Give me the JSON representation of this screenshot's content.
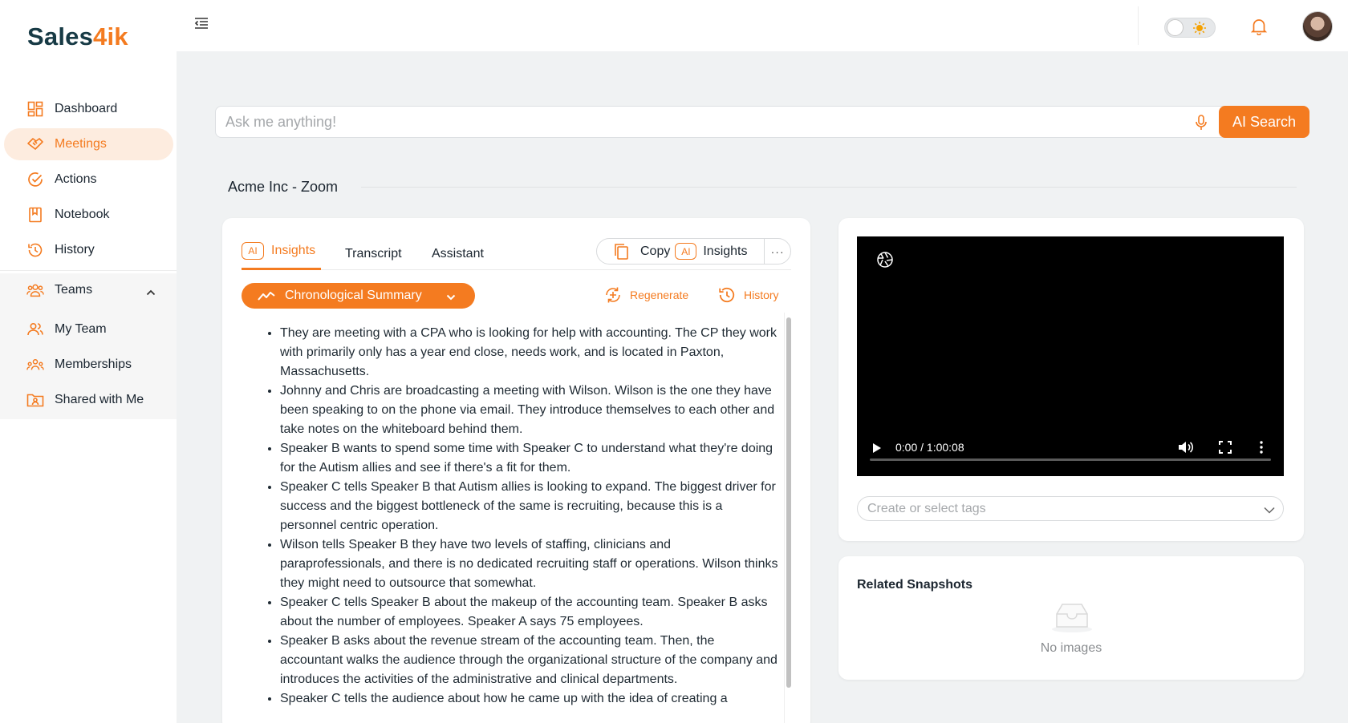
{
  "brand": {
    "logo_part1": "Sales",
    "logo_part2": "4ik"
  },
  "sidebar": {
    "items": [
      {
        "label": "Dashboard",
        "icon": "dashboard-icon"
      },
      {
        "label": "Meetings",
        "icon": "handshake-icon",
        "active": true
      },
      {
        "label": "Actions",
        "icon": "check-circle-icon"
      },
      {
        "label": "Notebook",
        "icon": "notebook-icon"
      },
      {
        "label": "History",
        "icon": "history-icon"
      }
    ],
    "teams": {
      "label": "Teams",
      "expanded": true,
      "children": [
        {
          "label": "My Team",
          "icon": "users-icon"
        },
        {
          "label": "Memberships",
          "icon": "group-icon"
        },
        {
          "label": "Shared with Me",
          "icon": "shared-folder-icon"
        }
      ]
    }
  },
  "topbar": {
    "theme": "light"
  },
  "search": {
    "placeholder": "Ask me anything!",
    "button_label": "AI Search"
  },
  "page": {
    "title": "Acme Inc - Zoom"
  },
  "insights_panel": {
    "tabs": [
      {
        "label": "Insights",
        "badge": "AI",
        "active": true
      },
      {
        "label": "Transcript"
      },
      {
        "label": "Assistant"
      }
    ],
    "copy_label": "Copy",
    "copy_badge": "AI",
    "copy_target": "Insights",
    "more_label": "···",
    "summary_type": "Chronological Summary",
    "regenerate_label": "Regenerate",
    "history_label": "History",
    "summary": [
      "They are meeting with a CPA who is looking for help with accounting. The CP they work with primarily only has a year end close, needs work, and is located in Paxton, Massachusetts.",
      "Johnny and Chris are broadcasting a meeting with Wilson. Wilson is the one they have been speaking to on the phone via email. They introduce themselves to each other and take notes on the whiteboard behind them.",
      "Speaker B wants to spend some time with Speaker C to understand what they're doing for the Autism allies and see if there's a fit for them.",
      "Speaker C tells Speaker B that Autism allies is looking to expand. The biggest driver for success and the biggest bottleneck of the same is recruiting, because this is a personnel centric operation.",
      "Wilson tells Speaker B they have two levels of staffing, clinicians and paraprofessionals, and there is no dedicated recruiting staff or operations. Wilson thinks they might need to outsource that somewhat.",
      "Speaker C tells Speaker B about the makeup of the accounting team. Speaker B asks about the number of employees. Speaker A says 75 employees.",
      "Speaker B asks about the revenue stream of the accounting team. Then, the accountant walks the audience through the organizational structure of the company and introduces the activities of the administrative and clinical departments.",
      "Speaker C tells the audience about how he came up with the idea of creating a"
    ]
  },
  "video": {
    "time": "0:00 / 1:00:08",
    "progress": 0
  },
  "tags": {
    "placeholder": "Create or select tags"
  },
  "snapshots": {
    "title": "Related Snapshots",
    "empty_text": "No images"
  },
  "colors": {
    "accent": "#f47b20",
    "brand_dark": "#173a45",
    "active_bg": "#fdecdf"
  }
}
